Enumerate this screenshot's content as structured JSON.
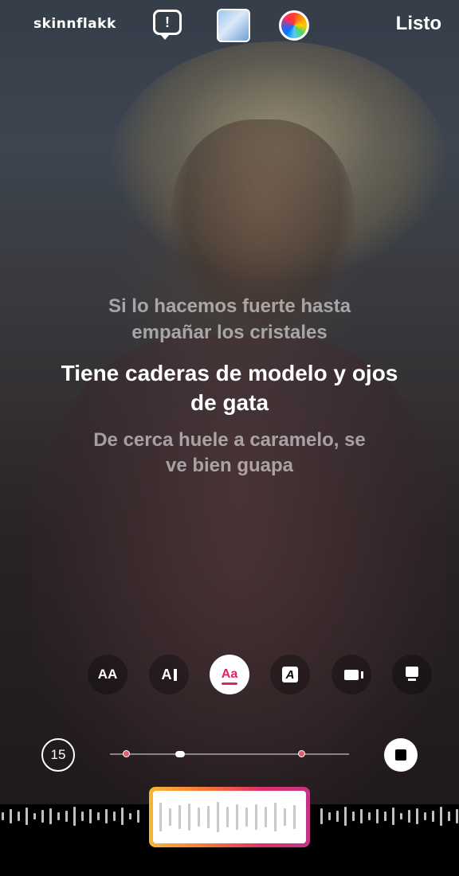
{
  "header": {
    "username": "skinnflakk",
    "report_icon": "exclamation-bubble-icon",
    "done_label": "Listo"
  },
  "lyrics": {
    "previous": [
      "Si lo hacemos fuerte hasta",
      "empañar los cristales"
    ],
    "current": [
      "Tiene caderas de modelo y ojos",
      "de gata"
    ],
    "next": [
      "De cerca huele a caramelo, se",
      "ve bien guapa"
    ]
  },
  "style_options": [
    {
      "name": "text-size",
      "label": "AA"
    },
    {
      "name": "text-cursor",
      "label": "A"
    },
    {
      "name": "lyrics-style",
      "label": "Aa",
      "active": true
    },
    {
      "name": "boxed-a",
      "label": "A"
    },
    {
      "name": "video-frame",
      "label": ""
    },
    {
      "name": "card",
      "label": ""
    }
  ],
  "player": {
    "duration_label": "15"
  },
  "colors": {
    "accent": "#e0245e",
    "gradient": [
      "#f7b733",
      "#f77737",
      "#e1306c",
      "#c13584"
    ]
  }
}
